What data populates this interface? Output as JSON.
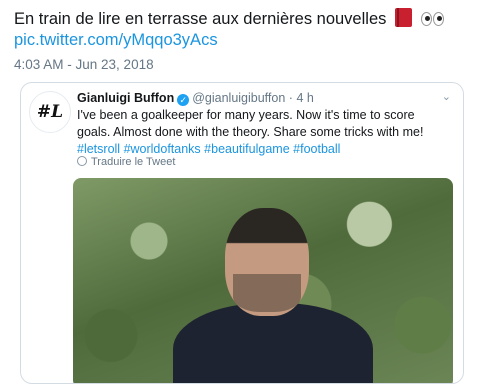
{
  "tweet": {
    "text": "En train de lire en terrasse aux dernières nouvelles",
    "emojis": [
      "closed-book-icon",
      "eyes-icon"
    ],
    "link": "pic.twitter.com/yMqqo3yAcs",
    "timestamp": "4:03 AM - Jun 23, 2018"
  },
  "quoted_tweet": {
    "avatar_text": "#L",
    "name": "Gianluigi Buffon",
    "handle": "@gianluigibuffon",
    "separator": "·",
    "age": "4 h",
    "body_plain": "I've been a goalkeeper for many years. Now it's time to score goals. Almost done with the theory. Share some tricks with me!",
    "hashtags": [
      "#letsroll",
      "#worldoftanks",
      "#beautifulgame",
      "#football"
    ],
    "translate_label": "Traduire le Tweet"
  },
  "colors": {
    "link": "#1b95e0",
    "muted": "#657786",
    "verified": "#1da1f2"
  }
}
